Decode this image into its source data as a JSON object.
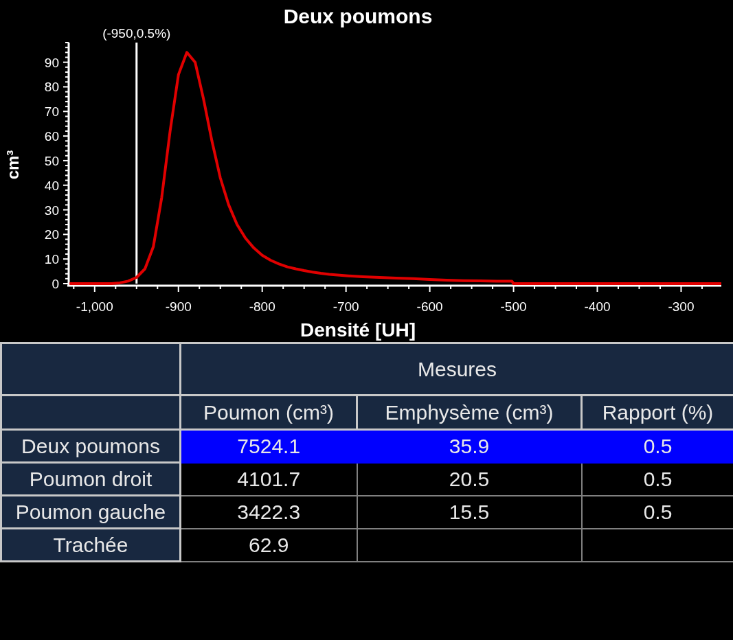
{
  "chart": {
    "chart_data": {
      "type": "line",
      "title": "Deux poumons",
      "xlabel": "Densité [UH]",
      "ylabel": "cm³",
      "x": [
        -1030,
        -1000,
        -980,
        -970,
        -960,
        -950,
        -940,
        -930,
        -920,
        -910,
        -900,
        -890,
        -880,
        -870,
        -860,
        -850,
        -840,
        -830,
        -820,
        -810,
        -800,
        -790,
        -780,
        -770,
        -760,
        -750,
        -740,
        -730,
        -720,
        -710,
        -700,
        -680,
        -660,
        -640,
        -620,
        -600,
        -580,
        -560,
        -540,
        -520,
        -502,
        -500,
        -450,
        -400,
        -350,
        -300,
        -252
      ],
      "series": [
        {
          "color": "#e00000",
          "values": [
            0,
            0,
            0,
            0.3,
            1,
            2.5,
            6,
            15,
            35,
            62,
            85,
            94,
            90,
            75,
            58,
            43,
            32,
            24,
            18.5,
            14.5,
            11.5,
            9.5,
            8,
            6.8,
            6,
            5.3,
            4.7,
            4.2,
            3.8,
            3.5,
            3.2,
            2.8,
            2.5,
            2.2,
            2,
            1.7,
            1.4,
            1.2,
            1.1,
            1,
            1,
            0,
            0,
            0,
            0,
            0,
            0
          ]
        }
      ],
      "xlim": [
        -1031,
        -252
      ],
      "ylim": [
        0,
        98
      ],
      "xticks": [
        {
          "value": -1000,
          "label": "-1,000"
        },
        -900,
        -800,
        -700,
        -600,
        -500,
        -400,
        -300
      ],
      "yticks": [
        0,
        10,
        20,
        30,
        40,
        50,
        60,
        70,
        80,
        90
      ],
      "ref_lines": [
        {
          "axis": "x",
          "value": -950,
          "label": "(-950,0.5%)"
        }
      ]
    }
  },
  "table": {
    "group_header": "Mesures",
    "columns": [
      "Poumon (cm³)",
      "Emphysème (cm³)",
      "Rapport (%)"
    ],
    "rows": [
      {
        "label": "Deux poumons",
        "selected": true,
        "cells": [
          "7524.1",
          "35.9",
          "0.5"
        ]
      },
      {
        "label": "Poumon droit",
        "selected": false,
        "cells": [
          "4101.7",
          "20.5",
          "0.5"
        ]
      },
      {
        "label": "Poumon gauche",
        "selected": false,
        "cells": [
          "3422.3",
          "15.5",
          "0.5"
        ]
      },
      {
        "label": "Trachée",
        "selected": false,
        "cells": [
          "62.9",
          "",
          ""
        ]
      }
    ]
  }
}
